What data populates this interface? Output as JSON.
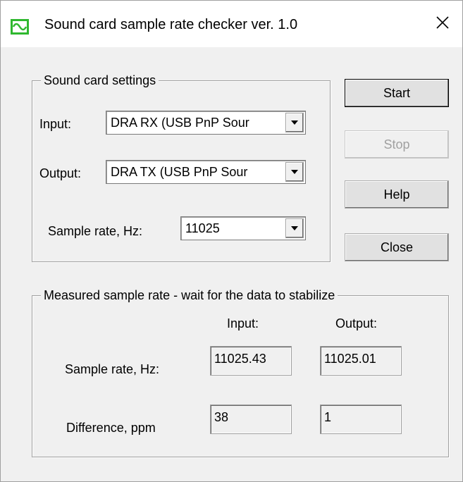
{
  "window": {
    "title": "Sound card sample rate checker ver. 1.0"
  },
  "icons": {
    "app": "sine-wave-app-icon",
    "close": "close-icon",
    "dropdown": "chevron-down-icon"
  },
  "colors": {
    "app_icon": "#2fb82f",
    "disabled_text": "#a0a0a0"
  },
  "settings": {
    "legend": "Sound card settings",
    "input_label": "Input:",
    "input_value": "DRA RX (USB PnP Sour",
    "output_label": "Output:",
    "output_value": "DRA TX (USB PnP Sour",
    "rate_label": "Sample rate, Hz:",
    "rate_value": "11025"
  },
  "buttons": {
    "start": "Start",
    "stop": "Stop",
    "help": "Help",
    "close": "Close"
  },
  "measured": {
    "legend": "Measured sample rate - wait for the data to stabilize",
    "col_input": "Input:",
    "col_output": "Output:",
    "rate_label": "Sample rate, Hz:",
    "rate_input": "11025.43",
    "rate_output": "11025.01",
    "diff_label": "Difference, ppm",
    "diff_input": "38",
    "diff_output": "1"
  }
}
